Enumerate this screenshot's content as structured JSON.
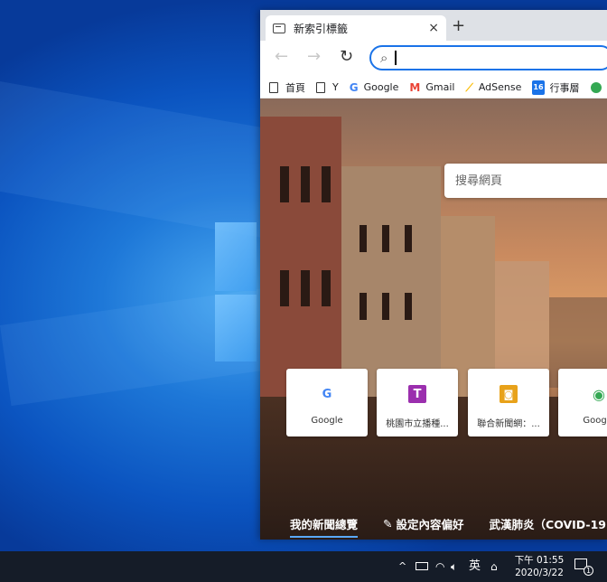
{
  "browser": {
    "tab": {
      "title": "新索引標籤",
      "close": "×"
    },
    "new_tab": "+",
    "nav": {
      "back": "←",
      "forward": "→",
      "refresh": "↻"
    },
    "address": {
      "value": "",
      "placeholder": ""
    },
    "favorites": [
      {
        "icon": "home-page-icon",
        "label": "首頁"
      },
      {
        "icon": "page-icon",
        "label": "Y"
      },
      {
        "icon": "google-icon",
        "label": "Google",
        "color": "#4285f4"
      },
      {
        "icon": "gmail-icon",
        "label": "Gmail",
        "color": "#ea4335"
      },
      {
        "icon": "adsense-icon",
        "label": "AdSense",
        "color": "#fbbc04"
      },
      {
        "icon": "calendar-icon",
        "label": "行事層",
        "color": "#1a73e8",
        "badge": "16"
      }
    ]
  },
  "newtab_page": {
    "search_placeholder": "搜尋網頁",
    "tiles": [
      {
        "label": "Google",
        "icon": "google-icon",
        "glyph": "G",
        "color": "#4285f4"
      },
      {
        "label": "桃園市立播種...",
        "icon": "t-icon",
        "glyph": "T",
        "color": "#9b2fae"
      },
      {
        "label": "聯合新聞網：...",
        "icon": "udn-icon",
        "glyph": "◙",
        "color": "#e8a21a"
      },
      {
        "label": "Google",
        "icon": "maps-icon",
        "glyph": "◉",
        "color": "#34a853"
      }
    ],
    "news_tabs": [
      {
        "label": "我的新聞總覽",
        "active": true
      },
      {
        "label": "設定內容偏好",
        "icon": "pencil-icon"
      },
      {
        "label": "武漢肺炎（COVID-19"
      }
    ]
  },
  "taskbar": {
    "tray": {
      "chevron": "^",
      "language": "英",
      "notifications_count": "1"
    },
    "clock": {
      "time": "下午 01:55",
      "date": "2020/3/22"
    }
  }
}
